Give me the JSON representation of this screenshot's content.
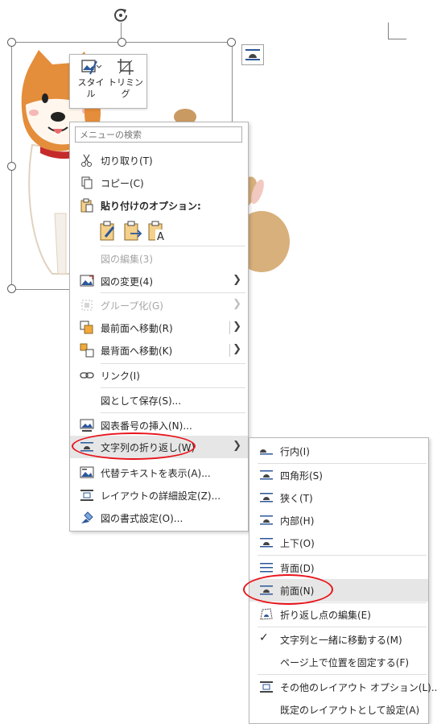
{
  "mini_toolbar": {
    "style_label": "スタイル",
    "trim_label": "トリミング"
  },
  "context_menu": {
    "search_placeholder": "メニューの検索",
    "cut": "切り取り(T)",
    "copy": "コピー(C)",
    "paste_options_heading": "貼り付けのオプション:",
    "edit_picture": "図の編集(3)",
    "change_picture": "図の変更(4)",
    "group": "グループ化(G)",
    "bring_to_front": "最前面へ移動(R)",
    "send_to_back": "最背面へ移動(K)",
    "link": "リンク(I)",
    "save_as_picture": "図として保存(S)...",
    "insert_caption": "図表番号の挿入(N)...",
    "wrap_text": "文字列の折り返し(W)",
    "alt_text": "代替テキストを表示(A)...",
    "layout_details": "レイアウトの詳細設定(Z)...",
    "format_picture": "図の書式設定(O)..."
  },
  "wrap_submenu": {
    "inline": "行内(I)",
    "square": "四角形(S)",
    "tight": "狭く(T)",
    "through": "内部(H)",
    "top_bottom": "上下(O)",
    "behind": "背面(D)",
    "in_front": "前面(N)",
    "edit_wrap_points": "折り返し点の編集(E)",
    "move_with_text": "文字列と一緒に移動する(M)",
    "fix_position": "ページ上で位置を固定する(F)",
    "more_layout": "その他のレイアウト オプション(L)...",
    "set_default": "既定のレイアウトとして設定(A)"
  },
  "colors": {
    "accent_blue": "#2b579a",
    "annotation_red": "#e8141b",
    "highlight": "#e6e6e6"
  }
}
